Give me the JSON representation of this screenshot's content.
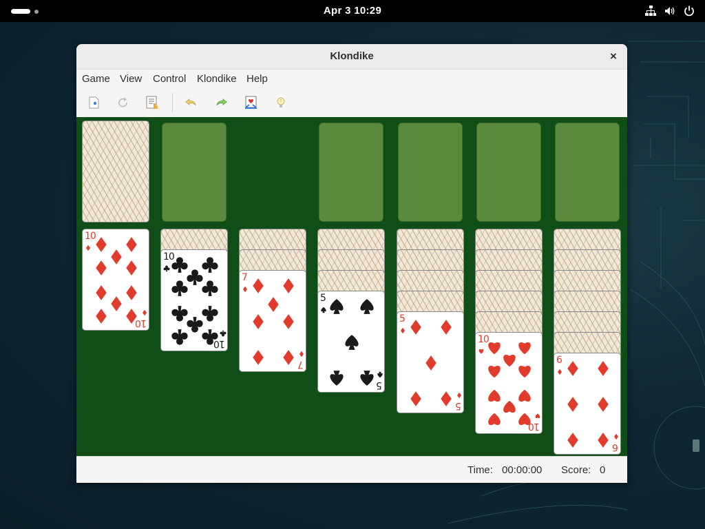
{
  "topbar": {
    "clock": "Apr 3  10:29",
    "tray_icons": [
      "network-icon",
      "volume-icon",
      "power-icon"
    ]
  },
  "window": {
    "title": "Klondike",
    "close_label": "×"
  },
  "menu": [
    "Game",
    "View",
    "Control",
    "Klondike",
    "Help"
  ],
  "toolbar": [
    "new-game-icon",
    "restart-icon",
    "select-game-icon",
    "undo-icon",
    "redo-icon",
    "deal-icon",
    "hint-icon"
  ],
  "tableau": [
    {
      "hidden": 0,
      "top": {
        "rank": "10",
        "suit": "diamonds"
      }
    },
    {
      "hidden": 1,
      "top": {
        "rank": "10",
        "suit": "clubs"
      }
    },
    {
      "hidden": 2,
      "top": {
        "rank": "7",
        "suit": "diamonds"
      }
    },
    {
      "hidden": 3,
      "top": {
        "rank": "5",
        "suit": "spades"
      }
    },
    {
      "hidden": 4,
      "top": {
        "rank": "5",
        "suit": "diamonds"
      }
    },
    {
      "hidden": 5,
      "top": {
        "rank": "10",
        "suit": "hearts"
      }
    },
    {
      "hidden": 6,
      "top": {
        "rank": "6",
        "suit": "diamonds"
      }
    }
  ],
  "stock": {
    "has_cards": true
  },
  "waste": {
    "empty": true
  },
  "foundations": 4,
  "status": {
    "time_label": "Time:",
    "time_value": "00:00:00",
    "score_label": "Score:",
    "score_value": "0"
  },
  "colors": {
    "felt": "#0f4e16",
    "slot": "#5b8a3c",
    "red_suit": "#e03b2b",
    "black_suit": "#1a1a1a"
  }
}
